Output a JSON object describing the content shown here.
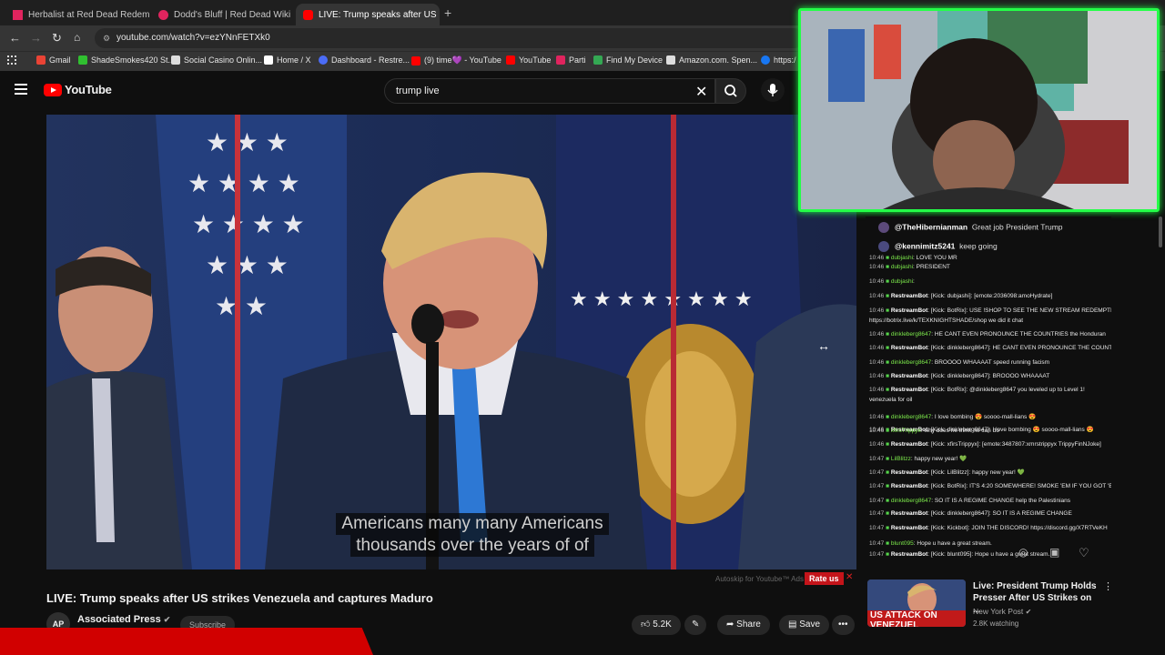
{
  "browser": {
    "tabs": [
      {
        "label": "Herbalist at Red Dead Redemp",
        "color": "#e0245e"
      },
      {
        "label": "Dodd's Bluff | Red Dead Wiki |",
        "color": "#e0245e"
      },
      {
        "label": "LIVE: Trump speaks after US",
        "color": "#ff0000"
      }
    ],
    "new_tab": "+",
    "url": "youtube.com/watch?v=ezYNnFETXk0",
    "bookmarks": [
      {
        "label": "Gmail",
        "color": "#ea4335"
      },
      {
        "label": "ShadeSmokes420 St...",
        "color": "#30c030"
      },
      {
        "label": "Social Casino Onlin...",
        "color": "#dddddd"
      },
      {
        "label": "Home / X",
        "color": "#ffffff"
      },
      {
        "label": "Dashboard - Restre...",
        "color": "#4b6cf7"
      },
      {
        "label": "(9) time💜 - YouTube",
        "color": "#ff0000"
      },
      {
        "label": "YouTube",
        "color": "#ff0000"
      },
      {
        "label": "Parti",
        "color": "#e0245e"
      },
      {
        "label": "Find My Device",
        "color": "#34a853"
      },
      {
        "label": "Amazon.com. Spen...",
        "color": "#dddddd"
      },
      {
        "label": "https:/",
        "color": "#1877f2"
      }
    ]
  },
  "youtube": {
    "logo_text": "YouTube",
    "search_query": "trump live",
    "captions": [
      "Americans many many Americans",
      "thousands over the years of of"
    ],
    "video_title": "LIVE: Trump speaks after US strikes Venezuela and captures Maduro",
    "channel_name": "Associated Press",
    "channel_avatar": "AP",
    "subscribe": "Subscribe",
    "likes": "5.2K",
    "share": "Share",
    "save": "Save",
    "autoskip_text": "Autoskip for Youtube™ Ads",
    "rate_us": "Rate us"
  },
  "chat": {
    "yt_messages": [
      {
        "user": "@TheHibernianman",
        "text": "Great job President Trump"
      },
      {
        "user": "@kennimitz5241",
        "text": "keep going"
      }
    ],
    "overlay_lines": [
      {
        "time": "10:46",
        "user": "dubjashi",
        "text": "LOVE YOU MR"
      },
      {
        "time": "10:46",
        "user": "dubjashi",
        "text": "PRESIDENT"
      },
      {
        "time": "10:46",
        "user": "dubjashi",
        "text": ""
      },
      {
        "time": "10:46",
        "user": "RestreamBot",
        "text": "[Kick: dubjashi]: [emote:2036098:amoHydrate]"
      },
      {
        "time": "10:46",
        "user": "RestreamBot",
        "text": "[Kick: BotRix]: USE !SHOP TO SEE THE NEW STREAM REDEMPTIONS FOR KICK!"
      },
      {
        "time": "",
        "user": "",
        "text": "https://botrix.live/k/TEXKNIGHTSHADE/shop  we did it chat"
      },
      {
        "time": "10:46",
        "user": "dinkleberg8647",
        "text": "HE CANT EVEN PRONOUNCE THE COUNTRIES   the Honduran"
      },
      {
        "time": "10:46",
        "user": "RestreamBot",
        "text": "[Kick: dinkleberg8647]: HE CANT EVEN PRONOUNCE THE COUNTRIES"
      },
      {
        "time": "10:46",
        "user": "dinkleberg8647",
        "text": "BROOOO WHAAAAT  speed running facism"
      },
      {
        "time": "10:46",
        "user": "RestreamBot",
        "text": "[Kick: dinkleberg8647]: BROOOO WHAAAAT"
      },
      {
        "time": "10:46",
        "user": "RestreamBot",
        "text": "[Kick: BotRix]: @dinkleberg8647 you leveled up to Level 1!"
      },
      {
        "time": "",
        "user": "",
        "text": "venezuela for oil"
      },
      {
        "time": "10:46",
        "user": "dinkleberg8647",
        "text": "I love bombing 😍 soooo-mall-lians 😍"
      },
      {
        "time": "10:46",
        "user": "RestreamBot",
        "text": "[Kick: dinkleberg8647]: I love bombing 😍 soooo-mall-lians 😍"
      },
      {
        "time": "10:46",
        "user": "xfirsTrippyx",
        "text": "why does he think he can do"
      },
      {
        "time": "10:46",
        "user": "RestreamBot",
        "text": "[Kick: xfirsTrippyx]: [emote:3487807:xmrstrippyx TrippyFinNJoke]"
      },
      {
        "time": "10:47",
        "user": "LilBlitzz",
        "text": "happy new year! 💚"
      },
      {
        "time": "10:47",
        "user": "RestreamBot",
        "text": "[Kick: LilBlitzz]: happy new year! 💚"
      },
      {
        "time": "10:47",
        "user": "RestreamBot",
        "text": "[Kick: BotRix]: IT'S 4:20 SOMEWHERE! SMOKE 'EM IF YOU GOT 'EM!"
      },
      {
        "time": "10:47",
        "user": "dinkleberg8647",
        "text": "SO IT IS A REGIME CHANGE   help the Palestinians"
      },
      {
        "time": "10:47",
        "user": "RestreamBot",
        "text": "[Kick: dinkleberg8647]: SO IT IS A REGIME CHANGE"
      },
      {
        "time": "10:47",
        "user": "RestreamBot",
        "text": "[Kick: Kickbot]: JOIN THE DISCORD! https://discord.gg/X7RTVeKH"
      },
      {
        "time": "10:47",
        "user": "blunt095",
        "text": "Hope u have a great stream."
      },
      {
        "time": "10:47",
        "user": "RestreamBot",
        "text": "[Kick: blunt095]: Hope u have a great stream."
      }
    ]
  },
  "recommended": {
    "title": "Live: President Trump Holds Presser After US Strikes on ...",
    "channel": "New York Post",
    "watching": "2.8K watching",
    "thumb_text": "US ATTACK ON VENEZUEL"
  }
}
